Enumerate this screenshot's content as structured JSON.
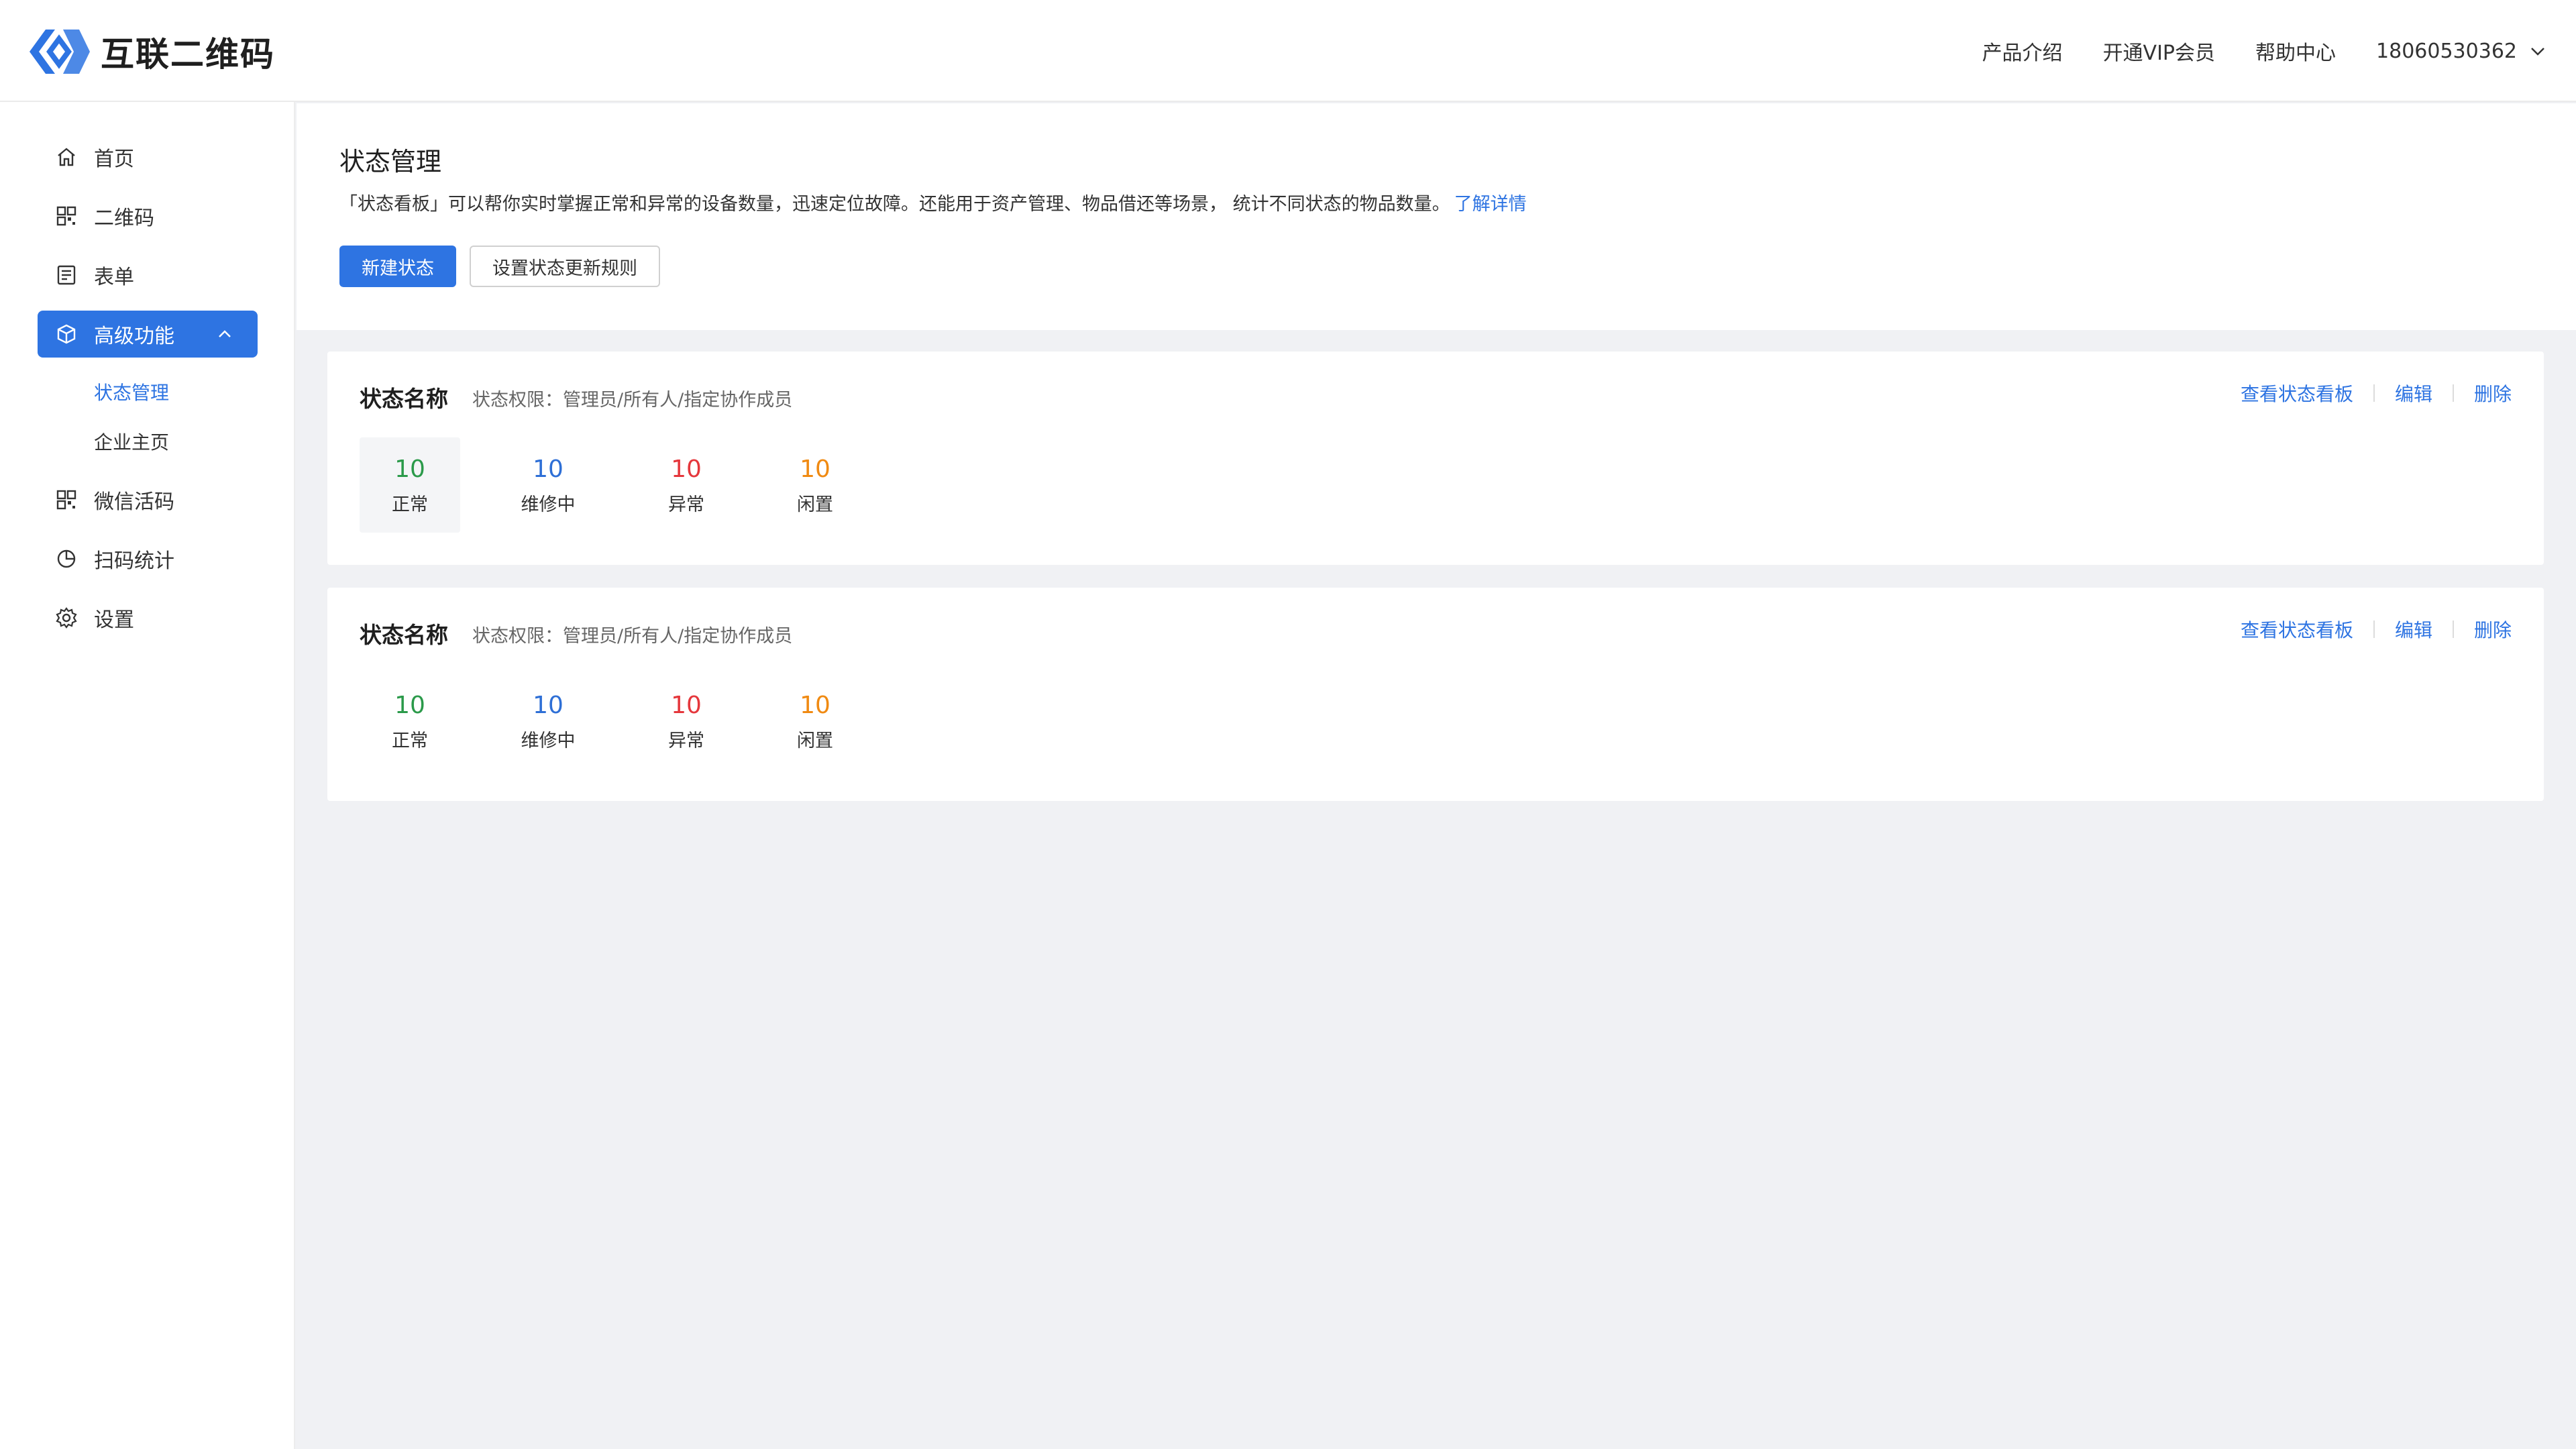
{
  "app": {
    "logo_text": "互联二维码"
  },
  "header": {
    "nav": [
      "产品介绍",
      "开通VIP会员",
      "帮助中心"
    ],
    "user": "18060530362"
  },
  "sidebar": {
    "items": [
      {
        "label": "首页",
        "icon": "home-icon"
      },
      {
        "label": "二维码",
        "icon": "qrcode-icon"
      },
      {
        "label": "表单",
        "icon": "form-icon"
      },
      {
        "label": "高级功能",
        "icon": "box-icon",
        "expanded": true
      },
      {
        "label": "微信活码",
        "icon": "qrcode-icon"
      },
      {
        "label": "扫码统计",
        "icon": "pie-chart-icon"
      },
      {
        "label": "设置",
        "icon": "gear-icon"
      }
    ],
    "sub_items": [
      {
        "label": "状态管理",
        "active": true
      },
      {
        "label": "企业主页",
        "active": false
      }
    ]
  },
  "main": {
    "title": "状态管理",
    "description": "「状态看板」可以帮你实时掌握正常和异常的设备数量，迅速定位故障。还能用于资产管理、物品借还等场景， 统计不同状态的物品数量。",
    "learn_more": "了解详情",
    "new_button": "新建状态",
    "rule_button": "设置状态更新规则"
  },
  "cards": [
    {
      "name": "状态名称",
      "permission": "状态权限：管理员/所有人/指定协作成员",
      "actions": [
        "查看状态看板",
        "编辑",
        "删除"
      ],
      "stats": [
        {
          "value": "10",
          "label": "正常",
          "color": "#2b9a4a"
        },
        {
          "value": "10",
          "label": "维修中",
          "color": "#2e6fd6"
        },
        {
          "value": "10",
          "label": "异常",
          "color": "#e5373c"
        },
        {
          "value": "10",
          "label": "闲置",
          "color": "#f08a12"
        }
      ]
    },
    {
      "name": "状态名称",
      "permission": "状态权限：管理员/所有人/指定协作成员",
      "actions": [
        "查看状态看板",
        "编辑",
        "删除"
      ],
      "stats": [
        {
          "value": "10",
          "label": "正常",
          "color": "#2b9a4a"
        },
        {
          "value": "10",
          "label": "维修中",
          "color": "#2e6fd6"
        },
        {
          "value": "10",
          "label": "异常",
          "color": "#e5373c"
        },
        {
          "value": "10",
          "label": "闲置",
          "color": "#f08a12"
        }
      ]
    }
  ],
  "colors": {
    "primary": "#2e74e2",
    "background": "#f0f1f4"
  }
}
